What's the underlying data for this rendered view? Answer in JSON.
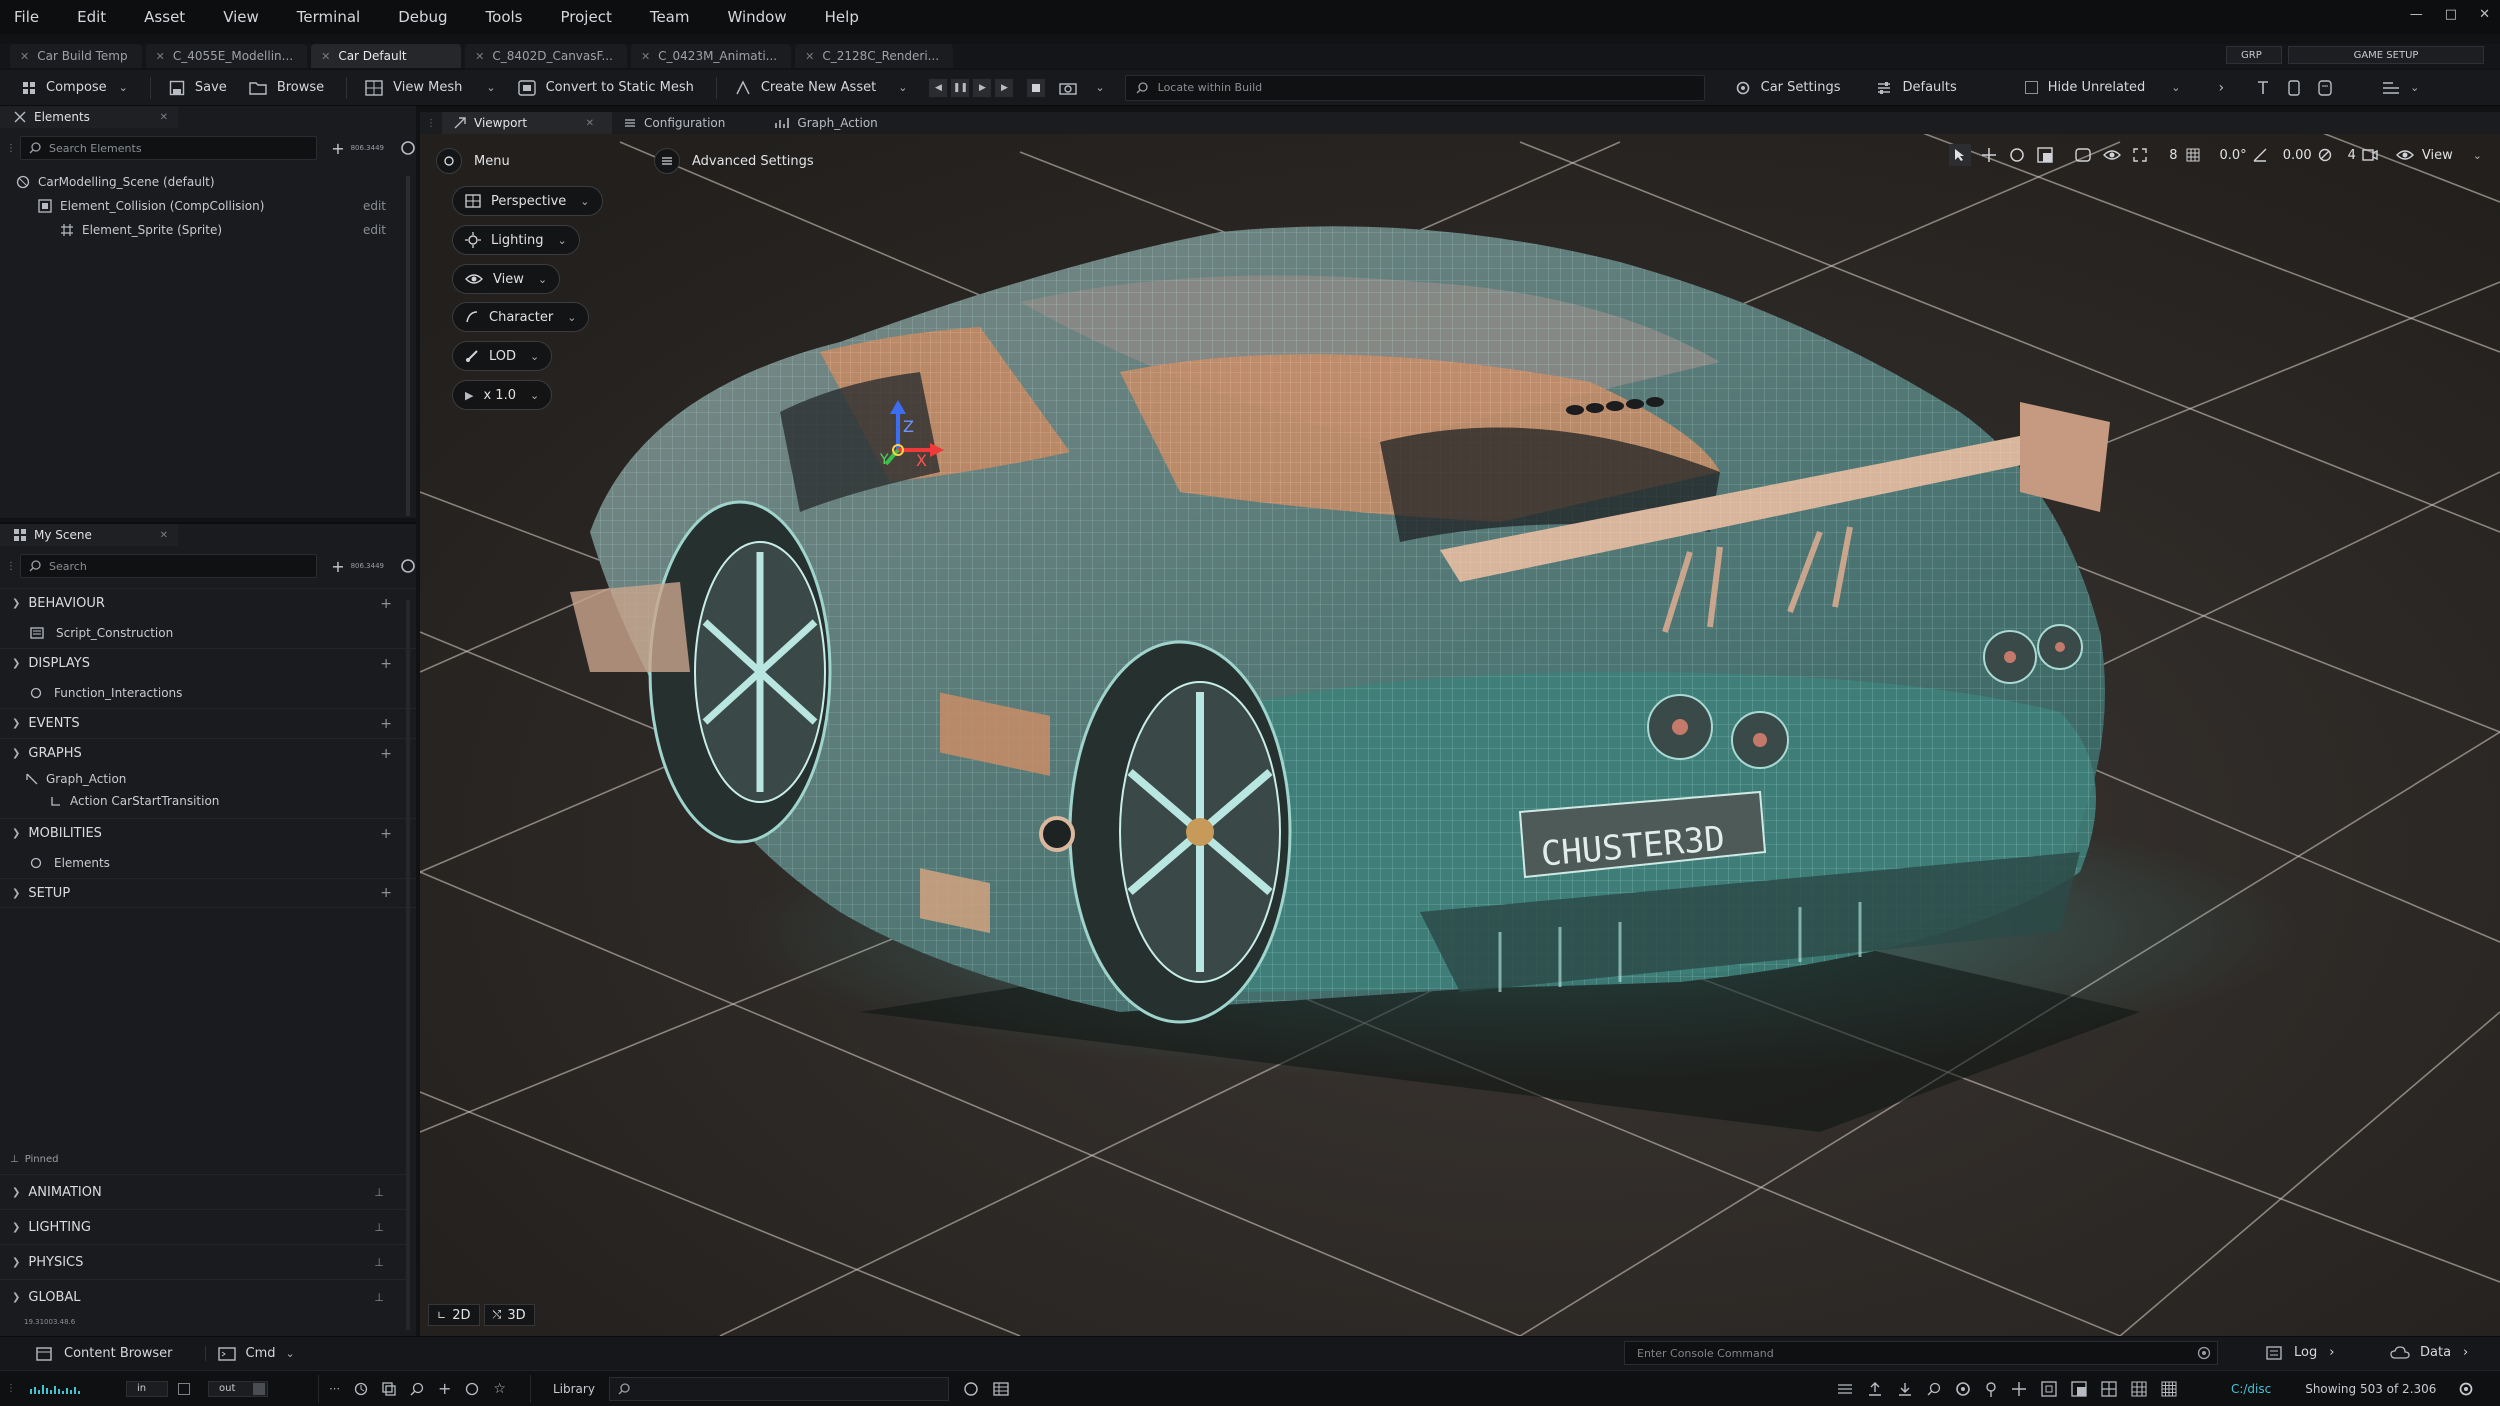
{
  "menubar": {
    "items": [
      "File",
      "Edit",
      "Asset",
      "View",
      "Terminal",
      "Debug",
      "Tools",
      "Project",
      "Team",
      "Window",
      "Help"
    ]
  },
  "doc_tabs": {
    "tabs": [
      "Car Build Temp",
      "C_4055E_Modellin...",
      "Car Default",
      "C_8402D_CanvasF...",
      "C_0423M_Animati...",
      "C_2128C_Renderi..."
    ],
    "active_index": 2,
    "right": [
      "GRP",
      "GAME SETUP"
    ]
  },
  "toolbar": {
    "compose": "Compose",
    "save": "Save",
    "browse": "Browse",
    "view_mesh": "View Mesh",
    "convert": "Convert to Static Mesh",
    "create_asset": "Create New Asset",
    "locate_placeholder": "Locate within Build",
    "car_settings": "Car Settings",
    "defaults": "Defaults",
    "hide_unrelated": "Hide Unrelated"
  },
  "elements_panel": {
    "tab": "Elements",
    "search_placeholder": "Search Elements",
    "count": "806.3449",
    "tree": [
      {
        "label": "CarModelling_Scene (default)",
        "edit": ""
      },
      {
        "label": "Element_Collision (CompCollision)",
        "edit": "edit"
      },
      {
        "label": "Element_Sprite (Sprite)",
        "edit": "edit"
      }
    ]
  },
  "scene_panel": {
    "tab": "My Scene",
    "search_placeholder": "Search",
    "count": "806.3449",
    "sections": [
      {
        "label": "BEHAVIOUR",
        "children": [
          "Script_Construction"
        ]
      },
      {
        "label": "DISPLAYS",
        "children": [
          "Function_Interactions"
        ]
      },
      {
        "label": "EVENTS",
        "children": []
      },
      {
        "label": "GRAPHS",
        "children": [
          "Graph_Action",
          "Action CarStartTransition"
        ]
      },
      {
        "label": "MOBILITIES",
        "children": [
          "Elements"
        ]
      },
      {
        "label": "SETUP",
        "children": []
      }
    ],
    "pinned_label": "Pinned",
    "pinned": [
      "ANIMATION",
      "LIGHTING",
      "PHYSICS",
      "GLOBAL"
    ],
    "version": "19.31003.48.6"
  },
  "viewport": {
    "tabs": [
      "Viewport",
      "Configuration",
      "Graph_Action"
    ],
    "menu": "Menu",
    "advanced": "Advanced Settings",
    "pills": [
      "Perspective",
      "Lighting",
      "View",
      "Character",
      "LOD",
      "x 1.0"
    ],
    "right_tools": {
      "grid": "8",
      "angle": "0.0°",
      "scale": "0.00",
      "cam": "4",
      "view": "View"
    },
    "mode_2d": "2D",
    "mode_3d": "3D",
    "plate": "CHUSTER3D",
    "axis": {
      "x": "X",
      "y": "Y",
      "z": "Z"
    }
  },
  "content_bar": {
    "content_browser": "Content Browser",
    "cmd": "Cmd",
    "console_placeholder": "Enter Console Command",
    "log": "Log",
    "data": "Data"
  },
  "status_bar": {
    "in": "in",
    "out": "out",
    "library": "Library",
    "path": "C:/disc",
    "showing": "Showing 503 of 2.306"
  },
  "colors": {
    "mesh_teal": "#4fc8c0",
    "mesh_orange": "#e5a07a",
    "ground": "#2f2c29",
    "accent_path": "#49c2d6"
  },
  "icons": [
    "search-icon",
    "plus-icon",
    "settings-icon",
    "save-icon",
    "folder-icon",
    "mesh-icon",
    "play-icon",
    "pause-icon",
    "stop-icon",
    "camera-icon",
    "eye-icon",
    "gear-icon"
  ]
}
